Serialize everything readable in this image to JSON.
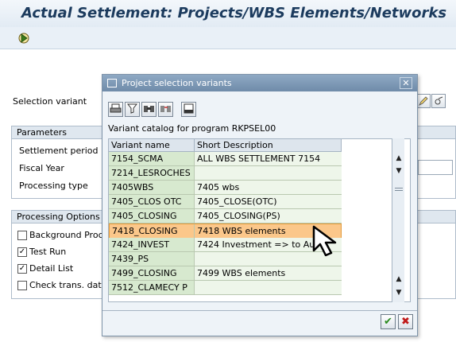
{
  "window": {
    "title": "Actual Settlement: Projects/WBS Elements/Networks"
  },
  "toolbar": {
    "execute_icon": "execute-icon"
  },
  "selection_variant": {
    "label": "Selection variant"
  },
  "parameters": {
    "title": "Parameters",
    "settlement_period": "Settlement period",
    "fiscal_year": "Fiscal Year",
    "processing_type": "Processing type"
  },
  "processing_options": {
    "title": "Processing Options",
    "items": [
      {
        "label": "Background Proce",
        "checked": false
      },
      {
        "label": "Test Run",
        "checked": true
      },
      {
        "label": "Detail List",
        "checked": true
      },
      {
        "label": "Check trans. data",
        "checked": false
      }
    ]
  },
  "dialog": {
    "title": "Project selection variants",
    "catalog_label": "Variant catalog for program RKPSEL00",
    "columns": [
      "Variant name",
      "Short Description"
    ],
    "rows": [
      {
        "name": "7154_SCMA",
        "desc": "ALL WBS SETTLEMENT 7154"
      },
      {
        "name": "7214_LESROCHES",
        "desc": ""
      },
      {
        "name": "7405WBS",
        "desc": "7405 wbs"
      },
      {
        "name": "7405_CLOS OTC",
        "desc": "7405_CLOSE(OTC)"
      },
      {
        "name": "7405_CLOSING",
        "desc": "7405_CLOSING(PS)"
      },
      {
        "name": "7418_CLOSING",
        "desc": "7418 WBS  elements"
      },
      {
        "name": "7424_INVEST",
        "desc": "7424 Investment => to Au"
      },
      {
        "name": "7439_PS",
        "desc": ""
      },
      {
        "name": "7499_CLOSING",
        "desc": "7499 WBS elements"
      },
      {
        "name": "7512_CLAMECY P",
        "desc": ""
      }
    ],
    "selected_row": 5
  },
  "colors": {
    "selected_row": "#fbc78a",
    "variant_cell": "#d7e9cf",
    "title": "#1c3b5e"
  }
}
